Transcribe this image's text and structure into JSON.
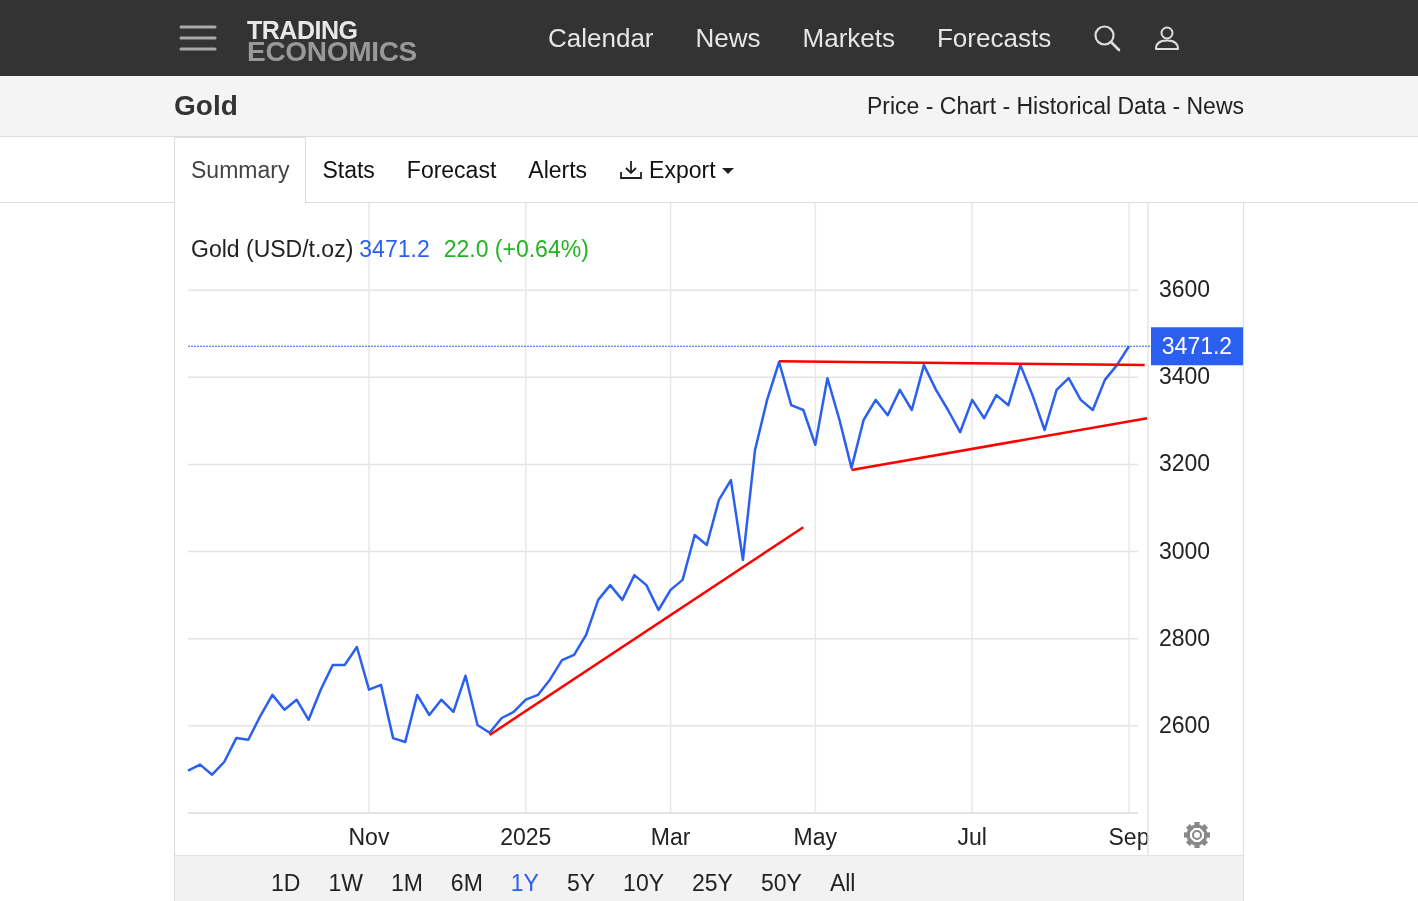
{
  "header": {
    "logo": {
      "line1": "TRADING",
      "line2": "ECONOMICS"
    },
    "nav": [
      "Calendar",
      "News",
      "Markets",
      "Forecasts"
    ]
  },
  "page": {
    "title": "Gold",
    "links": "Price - Chart - Historical Data - News"
  },
  "tabs": [
    {
      "label": "Summary",
      "selected": true,
      "kind": "tab"
    },
    {
      "label": "Stats",
      "selected": false,
      "kind": "tab"
    },
    {
      "label": "Forecast",
      "selected": false,
      "kind": "tab"
    },
    {
      "label": "Alerts",
      "selected": false,
      "kind": "tab"
    },
    {
      "label": "Export",
      "selected": false,
      "kind": "dropdown"
    }
  ],
  "chart": {
    "instrument": "Gold (USD/t.oz)",
    "price": "3471.2",
    "change": "22.0 (+0.64%)",
    "price_marker": {
      "label": "3471.2",
      "color": "#2b5ff0"
    },
    "trendlines": [
      {
        "color": "#ff0000"
      },
      {
        "color": "#ff0000"
      },
      {
        "color": "#ff0000"
      }
    ],
    "chart_data": {
      "type": "line",
      "grid": true,
      "categories": [
        null,
        null,
        null,
        null,
        null,
        null,
        null,
        null,
        null,
        null,
        null,
        null,
        null,
        null,
        null,
        "Nov",
        null,
        null,
        null,
        null,
        null,
        null,
        null,
        null,
        null,
        null,
        null,
        null,
        "2025",
        null,
        null,
        null,
        null,
        null,
        null,
        null,
        null,
        null,
        null,
        null,
        "Mar",
        null,
        null,
        null,
        null,
        null,
        null,
        null,
        null,
        null,
        null,
        null,
        "May",
        null,
        null,
        null,
        null,
        null,
        null,
        null,
        null,
        null,
        null,
        null,
        null,
        "Jul",
        null,
        null,
        null,
        null,
        null,
        null,
        null,
        null,
        null,
        null,
        null,
        null,
        "Sep"
      ],
      "series": [
        {
          "color": "#2b5ff0",
          "values": [
            2497,
            2511,
            2488,
            2517,
            2572,
            2568,
            2623,
            2671,
            2637,
            2660,
            2614,
            2683,
            2740,
            2740,
            2781,
            2683,
            2694,
            2572,
            2563,
            2671,
            2625,
            2660,
            2632,
            2715,
            2602,
            2584,
            2618,
            2632,
            2660,
            2671,
            2706,
            2751,
            2763,
            2809,
            2889,
            2923,
            2889,
            2946,
            2923,
            2866,
            2912,
            2935,
            3038,
            3015,
            3118,
            3164,
            2981,
            3233,
            3348,
            3435,
            3336,
            3325,
            3245,
            3398,
            3302,
            3192,
            3302,
            3348,
            3313,
            3371,
            3325,
            3428,
            3371,
            3325,
            3274,
            3348,
            3306,
            3359,
            3336,
            3428,
            3359,
            3279,
            3371,
            3398,
            3348,
            3325,
            3394,
            3428,
            3471
          ]
        }
      ],
      "ylim": [
        2400,
        3800
      ],
      "yticks": [
        2600,
        2800,
        3000,
        3200,
        3400,
        3600
      ]
    }
  },
  "ranges": [
    {
      "label": "1D",
      "selected": false
    },
    {
      "label": "1W",
      "selected": false
    },
    {
      "label": "1M",
      "selected": false
    },
    {
      "label": "6M",
      "selected": false
    },
    {
      "label": "1Y",
      "selected": true
    },
    {
      "label": "5Y",
      "selected": false
    },
    {
      "label": "10Y",
      "selected": false
    },
    {
      "label": "25Y",
      "selected": false
    },
    {
      "label": "50Y",
      "selected": false
    },
    {
      "label": "All",
      "selected": false
    }
  ]
}
